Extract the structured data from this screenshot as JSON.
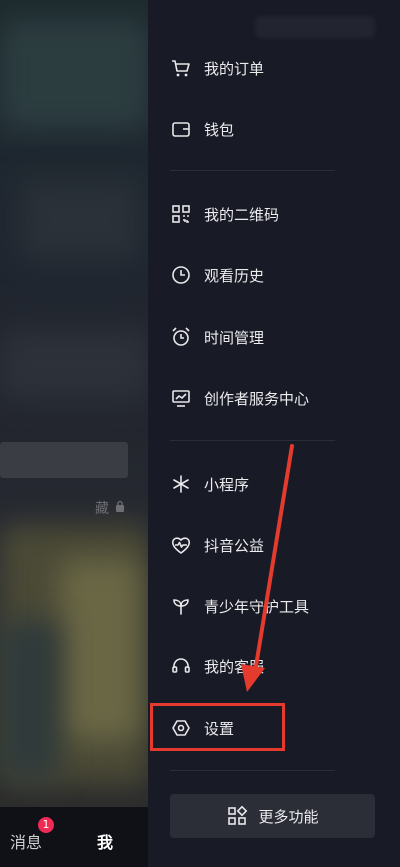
{
  "left_panel": {
    "collect_fragment": "藏",
    "bottom_tabs": {
      "messages_label": "消息",
      "messages_badge": "1",
      "me_label": "我"
    }
  },
  "drawer": {
    "items": [
      {
        "label": "我的订单",
        "icon": "cart-icon"
      },
      {
        "label": "钱包",
        "icon": "wallet-icon"
      },
      {
        "label": "我的二维码",
        "icon": "qrcode-icon"
      },
      {
        "label": "观看历史",
        "icon": "clock-icon"
      },
      {
        "label": "时间管理",
        "icon": "alarm-icon"
      },
      {
        "label": "创作者服务中心",
        "icon": "monitor-chart-icon"
      },
      {
        "label": "小程序",
        "icon": "asterisk-icon"
      },
      {
        "label": "抖音公益",
        "icon": "heart-pulse-icon"
      },
      {
        "label": "青少年守护工具",
        "icon": "sprout-icon"
      },
      {
        "label": "我的客服",
        "icon": "headset-icon"
      },
      {
        "label": "设置",
        "icon": "hexagon-settings-icon"
      }
    ],
    "more_button_label": "更多功能",
    "more_button_icon": "grid-icon"
  },
  "annotation": {
    "highlight_color": "#e53b2e",
    "highlighted_item": "设置"
  }
}
